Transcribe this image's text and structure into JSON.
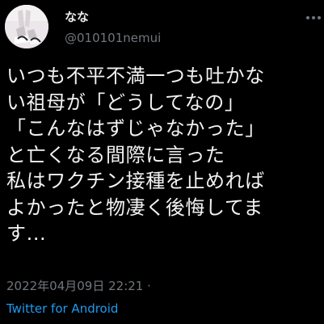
{
  "author": {
    "display_name": "なな",
    "handle": "@010101nemui"
  },
  "tweet": {
    "lines": [
      "いつも不平不満一つも吐かな",
      "い祖母が「どうしてなの」",
      "「こんなはずじゃなかった」",
      "と亡くなる間際に言った",
      "私はワクチン接種を止めれば",
      "よかったと物凄く後悔してま",
      "す..."
    ],
    "timestamp": "2022年04月09日 22:21 ·",
    "source": "Twitter for Android"
  },
  "icons": {
    "avatar": "avatar-photo",
    "more": "more-icon"
  },
  "colors": {
    "background": "#000000",
    "text": "#e7e9ea",
    "muted": "#71767b",
    "link": "#1d9bf0"
  }
}
